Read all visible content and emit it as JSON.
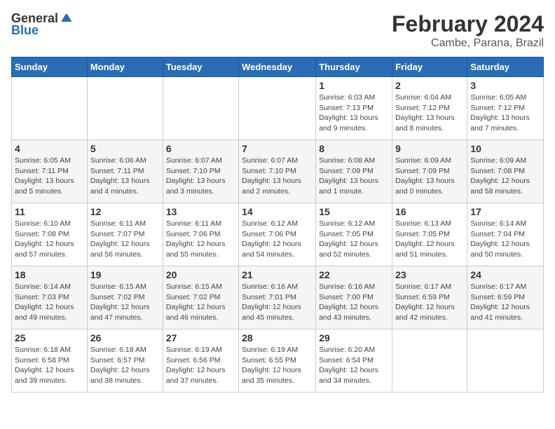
{
  "header": {
    "logo_general": "General",
    "logo_blue": "Blue",
    "month_title": "February 2024",
    "location": "Cambe, Parana, Brazil"
  },
  "days_of_week": [
    "Sunday",
    "Monday",
    "Tuesday",
    "Wednesday",
    "Thursday",
    "Friday",
    "Saturday"
  ],
  "weeks": [
    [
      {
        "day": "",
        "info": ""
      },
      {
        "day": "",
        "info": ""
      },
      {
        "day": "",
        "info": ""
      },
      {
        "day": "",
        "info": ""
      },
      {
        "day": "1",
        "info": "Sunrise: 6:03 AM\nSunset: 7:13 PM\nDaylight: 13 hours and 9 minutes."
      },
      {
        "day": "2",
        "info": "Sunrise: 6:04 AM\nSunset: 7:12 PM\nDaylight: 13 hours and 8 minutes."
      },
      {
        "day": "3",
        "info": "Sunrise: 6:05 AM\nSunset: 7:12 PM\nDaylight: 13 hours and 7 minutes."
      }
    ],
    [
      {
        "day": "4",
        "info": "Sunrise: 6:05 AM\nSunset: 7:11 PM\nDaylight: 13 hours and 5 minutes."
      },
      {
        "day": "5",
        "info": "Sunrise: 6:06 AM\nSunset: 7:11 PM\nDaylight: 13 hours and 4 minutes."
      },
      {
        "day": "6",
        "info": "Sunrise: 6:07 AM\nSunset: 7:10 PM\nDaylight: 13 hours and 3 minutes."
      },
      {
        "day": "7",
        "info": "Sunrise: 6:07 AM\nSunset: 7:10 PM\nDaylight: 13 hours and 2 minutes."
      },
      {
        "day": "8",
        "info": "Sunrise: 6:08 AM\nSunset: 7:09 PM\nDaylight: 13 hours and 1 minute."
      },
      {
        "day": "9",
        "info": "Sunrise: 6:09 AM\nSunset: 7:09 PM\nDaylight: 13 hours and 0 minutes."
      },
      {
        "day": "10",
        "info": "Sunrise: 6:09 AM\nSunset: 7:08 PM\nDaylight: 12 hours and 58 minutes."
      }
    ],
    [
      {
        "day": "11",
        "info": "Sunrise: 6:10 AM\nSunset: 7:08 PM\nDaylight: 12 hours and 57 minutes."
      },
      {
        "day": "12",
        "info": "Sunrise: 6:11 AM\nSunset: 7:07 PM\nDaylight: 12 hours and 56 minutes."
      },
      {
        "day": "13",
        "info": "Sunrise: 6:11 AM\nSunset: 7:06 PM\nDaylight: 12 hours and 55 minutes."
      },
      {
        "day": "14",
        "info": "Sunrise: 6:12 AM\nSunset: 7:06 PM\nDaylight: 12 hours and 54 minutes."
      },
      {
        "day": "15",
        "info": "Sunrise: 6:12 AM\nSunset: 7:05 PM\nDaylight: 12 hours and 52 minutes."
      },
      {
        "day": "16",
        "info": "Sunrise: 6:13 AM\nSunset: 7:05 PM\nDaylight: 12 hours and 51 minutes."
      },
      {
        "day": "17",
        "info": "Sunrise: 6:14 AM\nSunset: 7:04 PM\nDaylight: 12 hours and 50 minutes."
      }
    ],
    [
      {
        "day": "18",
        "info": "Sunrise: 6:14 AM\nSunset: 7:03 PM\nDaylight: 12 hours and 49 minutes."
      },
      {
        "day": "19",
        "info": "Sunrise: 6:15 AM\nSunset: 7:02 PM\nDaylight: 12 hours and 47 minutes."
      },
      {
        "day": "20",
        "info": "Sunrise: 6:15 AM\nSunset: 7:02 PM\nDaylight: 12 hours and 46 minutes."
      },
      {
        "day": "21",
        "info": "Sunrise: 6:16 AM\nSunset: 7:01 PM\nDaylight: 12 hours and 45 minutes."
      },
      {
        "day": "22",
        "info": "Sunrise: 6:16 AM\nSunset: 7:00 PM\nDaylight: 12 hours and 43 minutes."
      },
      {
        "day": "23",
        "info": "Sunrise: 6:17 AM\nSunset: 6:59 PM\nDaylight: 12 hours and 42 minutes."
      },
      {
        "day": "24",
        "info": "Sunrise: 6:17 AM\nSunset: 6:59 PM\nDaylight: 12 hours and 41 minutes."
      }
    ],
    [
      {
        "day": "25",
        "info": "Sunrise: 6:18 AM\nSunset: 6:58 PM\nDaylight: 12 hours and 39 minutes."
      },
      {
        "day": "26",
        "info": "Sunrise: 6:18 AM\nSunset: 6:57 PM\nDaylight: 12 hours and 38 minutes."
      },
      {
        "day": "27",
        "info": "Sunrise: 6:19 AM\nSunset: 6:56 PM\nDaylight: 12 hours and 37 minutes."
      },
      {
        "day": "28",
        "info": "Sunrise: 6:19 AM\nSunset: 6:55 PM\nDaylight: 12 hours and 35 minutes."
      },
      {
        "day": "29",
        "info": "Sunrise: 6:20 AM\nSunset: 6:54 PM\nDaylight: 12 hours and 34 minutes."
      },
      {
        "day": "",
        "info": ""
      },
      {
        "day": "",
        "info": ""
      }
    ]
  ]
}
